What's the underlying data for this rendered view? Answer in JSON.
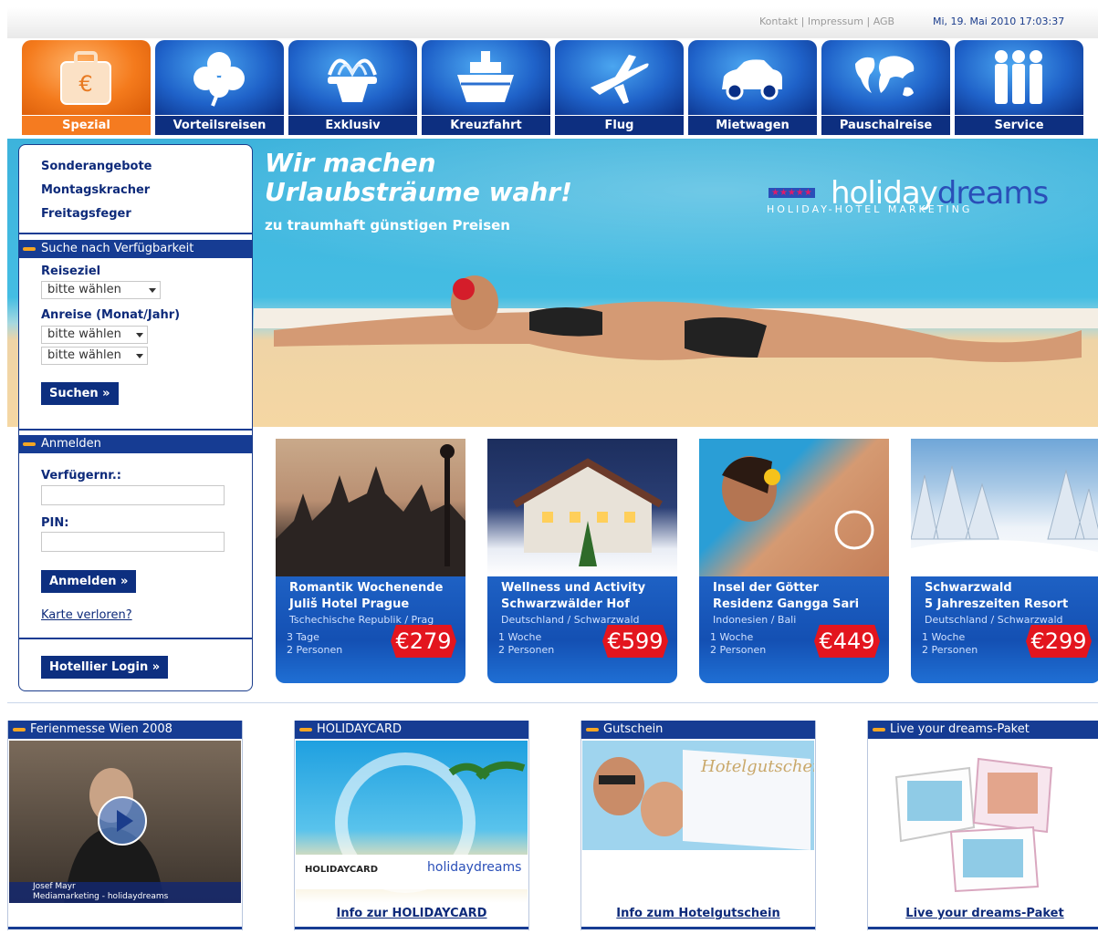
{
  "topbar": {
    "links": [
      "Kontakt",
      "Impressum",
      "AGB"
    ],
    "separator": "|",
    "datetime": "Mi, 19. Mai 2010  17:03:37"
  },
  "nav": {
    "tabs": [
      {
        "label": "Spezial",
        "icon": "suitcase-euro-icon",
        "active": true
      },
      {
        "label": "Vorteilsreisen",
        "icon": "clover-icon"
      },
      {
        "label": "Exklusiv",
        "icon": "fountain-icon"
      },
      {
        "label": "Kreuzfahrt",
        "icon": "ship-icon"
      },
      {
        "label": "Flug",
        "icon": "airplane-icon"
      },
      {
        "label": "Mietwagen",
        "icon": "car-icon"
      },
      {
        "label": "Pauschalreise",
        "icon": "world-map-icon"
      },
      {
        "label": "Service",
        "icon": "people-icon"
      }
    ]
  },
  "hero": {
    "line1": "Wir machen",
    "line2": "Urlaubsträume wahr!",
    "line3": "zu traumhaft günstigen Preisen",
    "brand": {
      "stars": "★★★★★",
      "name_part1": "holiday",
      "name_part2": "dreams",
      "sub": "HOLIDAY-HOTEL MARKETING"
    }
  },
  "sidebar": {
    "links": [
      "Sonderangebote",
      "Montagskracher",
      "Freitagsfeger"
    ],
    "search": {
      "heading": "Suche nach Verfügbarkeit",
      "destination_label": "Reiseziel",
      "destination_value": "bitte wählen",
      "arrival_label": "Anreise (Monat/Jahr)",
      "month_value": "bitte wählen",
      "year_value": "bitte wählen",
      "submit": "Suchen »"
    },
    "login": {
      "heading": "Anmelden",
      "user_label": "Verfügernr.:",
      "pin_label": "PIN:",
      "submit": "Anmelden »",
      "lost_card": "Karte verloren?"
    },
    "hotelier": "Hotellier Login »"
  },
  "offers": [
    {
      "title": "Romantik Wochenende",
      "hotel": "Juliš Hotel Prague",
      "location": "Tschechische Republik / Prag",
      "duration": "3 Tage",
      "persons": "2 Personen",
      "price": "€279"
    },
    {
      "title": "Wellness und Activity",
      "hotel": "Schwarzwälder Hof",
      "location": "Deutschland / Schwarzwald",
      "duration": "1 Woche",
      "persons": "2 Personen",
      "price": "€599"
    },
    {
      "title": "Insel der Götter",
      "hotel": "Residenz Gangga Sari",
      "location": "Indonesien / Bali",
      "duration": "1 Woche",
      "persons": "2 Personen",
      "price": "€449"
    },
    {
      "title": "Schwarzwald",
      "hotel": "5 Jahreszeiten Resort",
      "location": "Deutschland / Schwarzwald",
      "duration": "1 Woche",
      "persons": "2 Personen",
      "price": "€299"
    }
  ],
  "bottom": [
    {
      "heading": "Ferienmesse Wien 2008",
      "caption1": "Josef Mayr",
      "caption2": "Mediamarketing - holidaydreams",
      "link": ""
    },
    {
      "heading": "HOLIDAYCARD",
      "card_text1": "HOLIDAYCARD",
      "card_text2": "holidaydreams",
      "link": "Info zur HOLIDAYCARD"
    },
    {
      "heading": "Gutschein",
      "voucher_text": "Hotelgutschein",
      "link": "Info zum Hotelgutschein"
    },
    {
      "heading": "Live your dreams-Paket",
      "link": "Live your dreams-Paket"
    }
  ]
}
